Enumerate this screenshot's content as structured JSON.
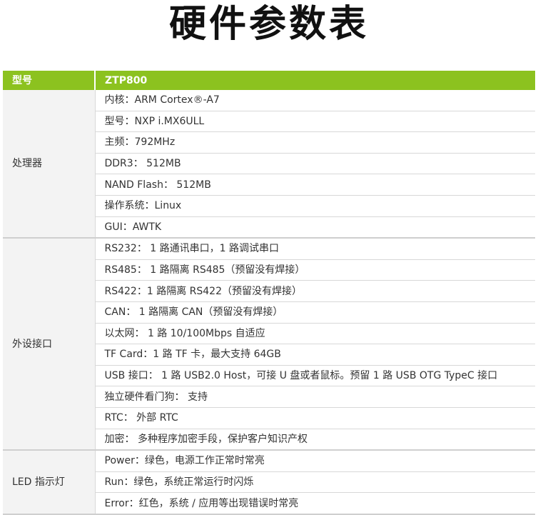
{
  "title": "硬件参数表",
  "header": {
    "col1": "型号",
    "col2": "ZTP800"
  },
  "sections": [
    {
      "category": "处理器",
      "rows": [
        "内核：ARM Cortex®-A7",
        "型号：NXP i.MX6ULL",
        "主频：792MHz",
        "DDR3： 512MB",
        "NAND Flash： 512MB",
        "操作系统：Linux",
        "GUI：AWTK"
      ]
    },
    {
      "category": "外设接口",
      "rows": [
        "RS232： 1 路通讯串口，1 路调试串口",
        "RS485： 1 路隔离 RS485（预留没有焊接）",
        "RS422：1 路隔离 RS422（预留没有焊接）",
        "CAN： 1 路隔离 CAN（预留没有焊接）",
        "以太网： 1 路 10/100Mbps 自适应",
        "TF Card：1 路 TF 卡，最大支持 64GB",
        "USB 接口： 1 路 USB2.0 Host，可接 U 盘或者鼠标。预留 1 路 USB OTG TypeC 接口",
        "独立硬件看门狗： 支持",
        "RTC： 外部 RTC",
        "加密： 多种程序加密手段，保护客户知识产权"
      ]
    },
    {
      "category": "LED 指示灯",
      "rows": [
        "Power：绿色，电源工作正常时常亮",
        "Run：绿色，系统正常运行时闪烁",
        "Error：红色，系统 / 应用等出现错误时常亮"
      ]
    }
  ],
  "colors": {
    "header_bg": "#8cc21f",
    "header_text": "#ffffff",
    "category_bg": "#f3f3f3"
  }
}
